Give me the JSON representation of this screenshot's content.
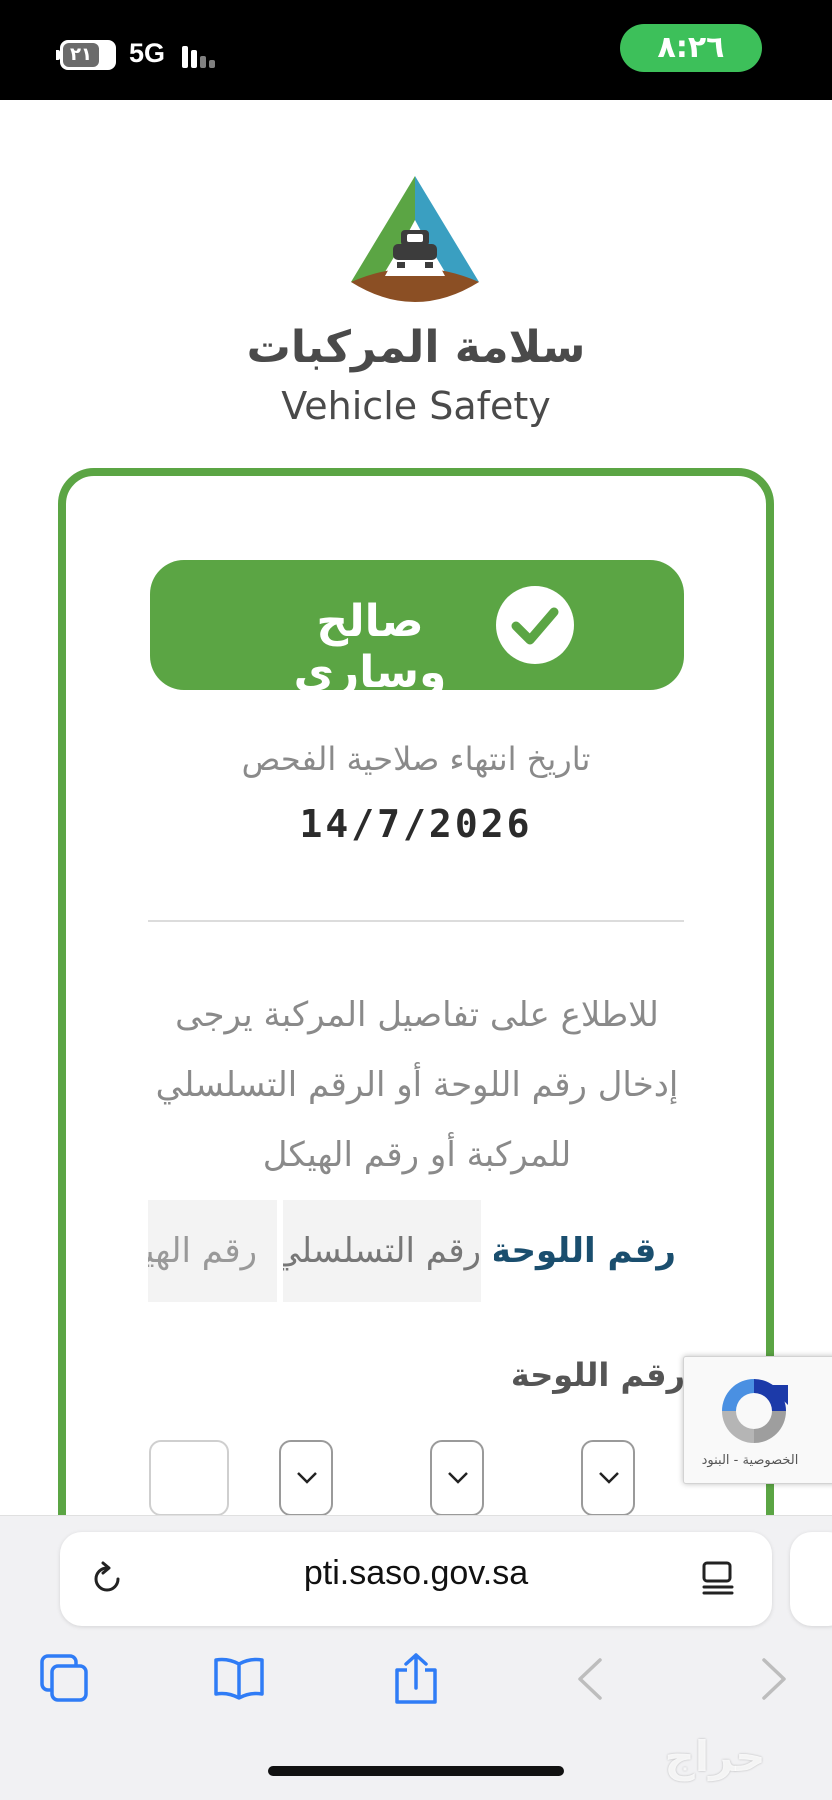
{
  "status_bar": {
    "battery": "٢١",
    "network": "5G",
    "time": "٨:٢٦"
  },
  "brand": {
    "name_ar": "سلامة المركبات",
    "name_en": "Vehicle Safety"
  },
  "result": {
    "status_label": "صالح وساري"
  },
  "expiry": {
    "label": "تاريخ انتهاء صلاحية الفحص",
    "date": "14/7/2026"
  },
  "instructions": "للاطلاع على تفاصيل المركبة يرجى إدخال رقم اللوحة أو الرقم التسلسلي للمركبة أو رقم الهيكل",
  "tabs": [
    {
      "label": "رقم اللوحة",
      "selected": true
    },
    {
      "label": "رقم التسلسلي",
      "selected": false
    },
    {
      "label": "رقم الهيكل",
      "selected": false
    }
  ],
  "plate_form": {
    "label": "رقم اللوحة"
  },
  "recaptcha": {
    "links": "الخصوصية - البنود"
  },
  "browser": {
    "url": "pti.saso.gov.sa"
  },
  "watermark": "حراج",
  "colors": {
    "brand_green": "#5ba544",
    "brand_blue": "#3a9fc1",
    "brand_brown": "#8b4f24",
    "tab_active": "#1a4e6e",
    "ios_blue": "#2f7cf6"
  }
}
